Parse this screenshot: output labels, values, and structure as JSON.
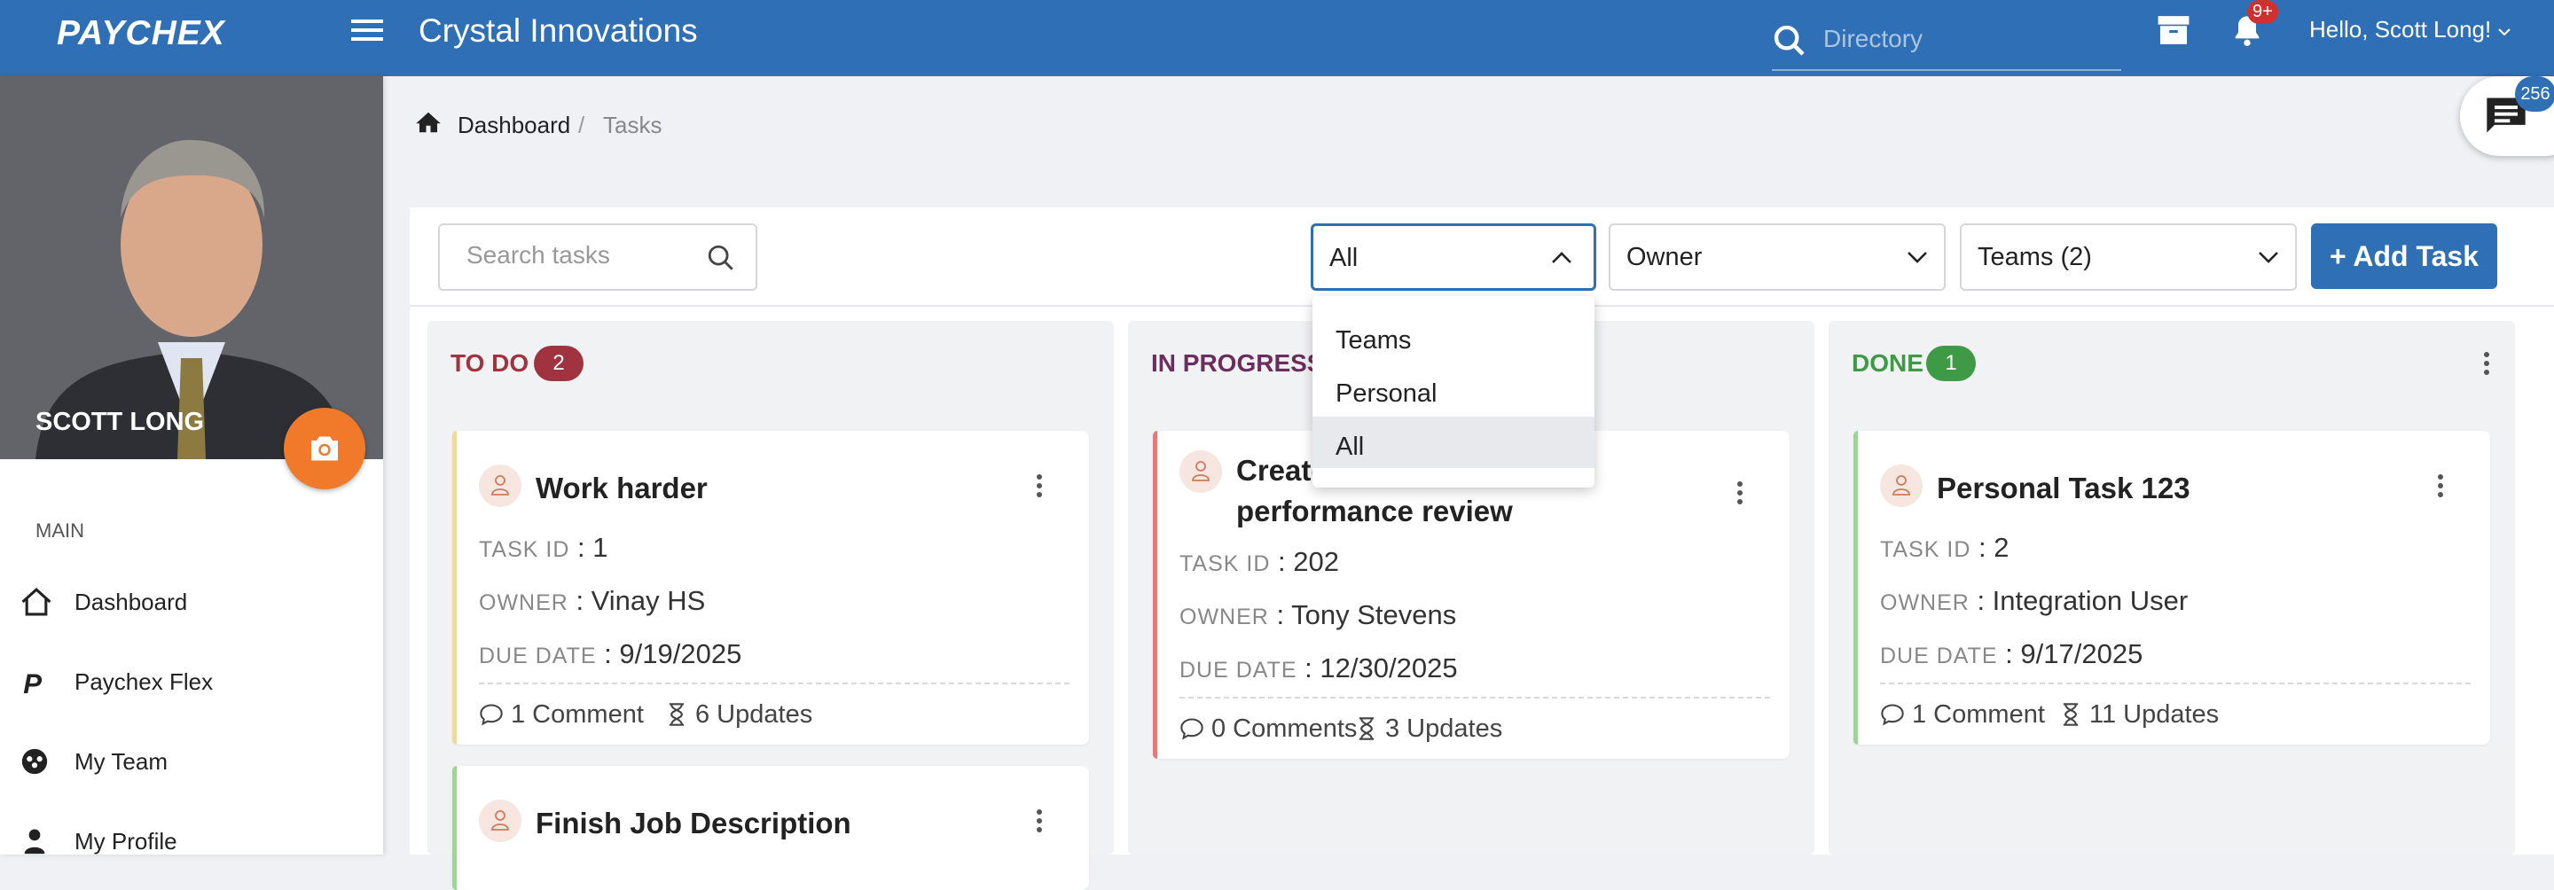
{
  "header": {
    "logo": "PAYCHEX",
    "company": "Crystal Innovations",
    "directory_placeholder": "Directory",
    "notification_count": "9+",
    "greeting": "Hello, Scott Long!"
  },
  "sidebar": {
    "user_name": "SCOTT LONG",
    "section_label": "MAIN",
    "items": [
      {
        "label": "Dashboard",
        "icon": "home-icon"
      },
      {
        "label": "Paychex Flex",
        "icon": "paychex-p-icon"
      },
      {
        "label": "My Team",
        "icon": "team-icon"
      },
      {
        "label": "My Profile",
        "icon": "person-icon"
      }
    ]
  },
  "breadcrumb": {
    "items": [
      "Dashboard",
      "Tasks"
    ],
    "separator": "/"
  },
  "toolbar": {
    "search_placeholder": "Search tasks",
    "scope_select": "All",
    "owner_select": "Owner",
    "teams_select": "Teams (2)",
    "add_task": "+ Add Task"
  },
  "scope_dropdown": {
    "options": [
      "Teams",
      "Personal",
      "All"
    ],
    "selected": "All"
  },
  "chat": {
    "badge": "256"
  },
  "columns": [
    {
      "title": "TO DO",
      "count": "2",
      "color": "#a0333f",
      "cards": [
        {
          "title": "Work harder",
          "task_id_label": "TASK ID",
          "task_id": "1",
          "owner_label": "OWNER",
          "owner": "Vinay HS",
          "due_label": "DUE DATE",
          "due": "9/19/2025",
          "comments": "1 Comment",
          "updates": "6 Updates",
          "accent": "#f0d9a0"
        },
        {
          "title": "Finish Job Description",
          "accent": "#9fd39a"
        }
      ]
    },
    {
      "title": "IN PROGRESS",
      "count": "",
      "color": "#6b2d5e",
      "cards": [
        {
          "title_line1": "Create",
          "title_line2": "performance review",
          "task_id_label": "TASK ID",
          "task_id": "202",
          "owner_label": "OWNER",
          "owner": "Tony Stevens",
          "due_label": "DUE DATE",
          "due": "12/30/2025",
          "comments": "0 Comments",
          "updates": "3 Updates",
          "accent": "#e57a7a"
        }
      ]
    },
    {
      "title": "DONE",
      "count": "1",
      "color": "#3e9a45",
      "cards": [
        {
          "title": "Personal Task 123",
          "task_id_label": "TASK ID",
          "task_id": "2",
          "owner_label": "OWNER",
          "owner": "Integration User",
          "due_label": "DUE DATE",
          "due": "9/17/2025",
          "comments": "1 Comment",
          "updates": "11 Updates",
          "accent": "#9fd39a"
        }
      ]
    }
  ]
}
